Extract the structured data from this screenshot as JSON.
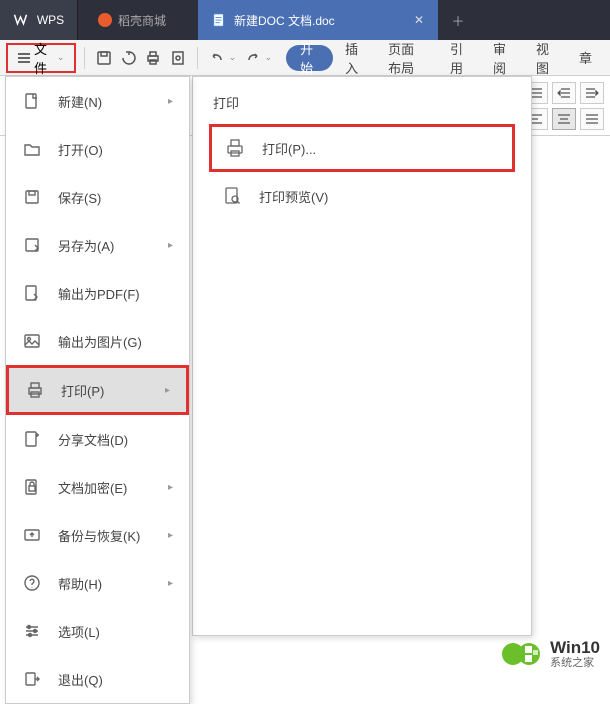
{
  "titlebar": {
    "wps_label": "WPS",
    "docer_label": "稻壳商城",
    "doc_tab_label": "新建DOC 文档.doc"
  },
  "toolbar": {
    "file_label": "文件"
  },
  "ribbon": {
    "tabs": [
      "开始",
      "插入",
      "页面布局",
      "引用",
      "审阅",
      "视图",
      "章"
    ]
  },
  "file_menu": {
    "items": [
      {
        "label": "新建(N)",
        "icon": "new",
        "arrow": true
      },
      {
        "label": "打开(O)",
        "icon": "open",
        "arrow": false
      },
      {
        "label": "保存(S)",
        "icon": "save",
        "arrow": false
      },
      {
        "label": "另存为(A)",
        "icon": "saveas",
        "arrow": true
      },
      {
        "label": "输出为PDF(F)",
        "icon": "pdf",
        "arrow": false
      },
      {
        "label": "输出为图片(G)",
        "icon": "image",
        "arrow": false
      },
      {
        "label": "打印(P)",
        "icon": "print",
        "arrow": true,
        "selected": true
      },
      {
        "label": "分享文档(D)",
        "icon": "share",
        "arrow": false
      },
      {
        "label": "文档加密(E)",
        "icon": "encrypt",
        "arrow": true
      },
      {
        "label": "备份与恢复(K)",
        "icon": "backup",
        "arrow": true
      },
      {
        "label": "帮助(H)",
        "icon": "help",
        "arrow": true
      },
      {
        "label": "选项(L)",
        "icon": "options",
        "arrow": false
      },
      {
        "label": "退出(Q)",
        "icon": "exit",
        "arrow": false
      }
    ]
  },
  "submenu": {
    "title": "打印",
    "items": [
      {
        "label": "打印(P)...",
        "icon": "print",
        "highlight": true
      },
      {
        "label": "打印预览(V)",
        "icon": "preview",
        "highlight": false
      }
    ]
  },
  "watermark": {
    "big": "Win10",
    "small": "系统之家"
  }
}
